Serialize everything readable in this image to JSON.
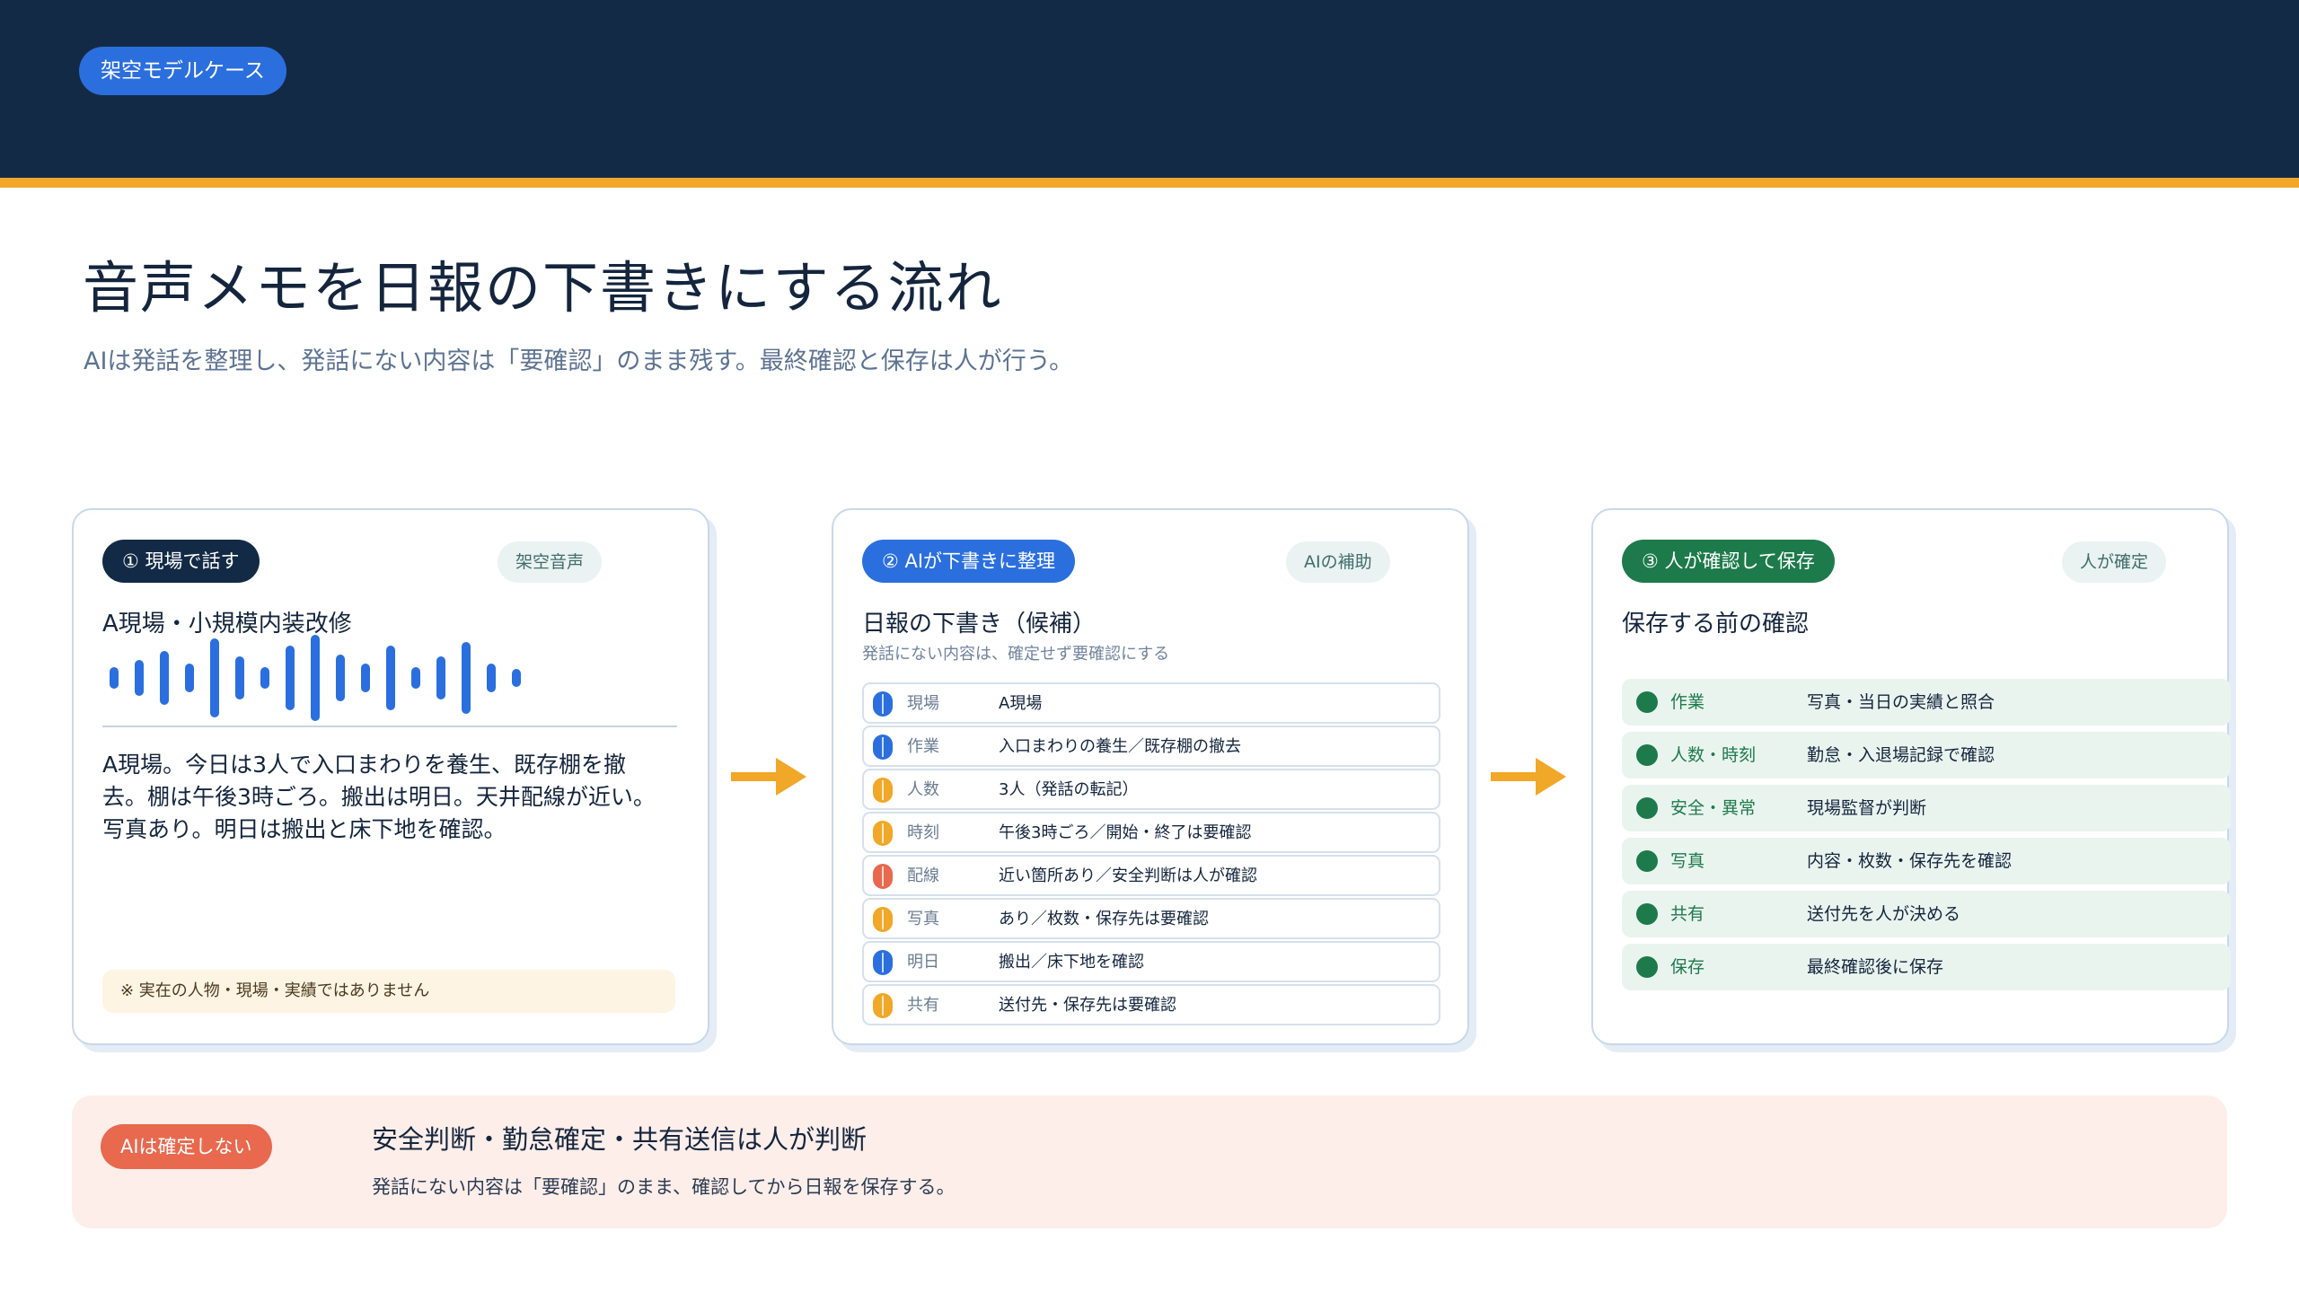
{
  "header": {
    "case_label": "架空モデルケース"
  },
  "title": "音声メモを日報の下書きにする流れ",
  "subtitle": "AIは発話を整理し、発話にない内容は「要確認」のまま残す。最終確認と保存は人が行う。",
  "colors": {
    "navy": "#132a46",
    "accent_yellow": "#f1a727",
    "blue": "#2b6fde",
    "orange": "#f1a727",
    "red": "#e8694e",
    "green": "#1d7a4b"
  },
  "step1": {
    "pill": "① 現場で話す",
    "tag": "架空音声",
    "heading": "A現場・小規模内装改修",
    "transcript": "A現場。今日は3人で入口まわりを養生、既存棚を撤去。棚は午後3時ごろ。搬出は明日。天井配線が近い。写真あり。明日は搬出と床下地を確認。",
    "disclaimer": "※ 実在の人物・現場・実績ではありません"
  },
  "step2": {
    "pill": "② AIが下書きに整理",
    "tag": "AIの補助",
    "heading": "日報の下書き（候補）",
    "note": "発話にない内容は、確定せず要確認にする",
    "rows": [
      {
        "key": "現場",
        "value": "A現場",
        "status": "blue"
      },
      {
        "key": "作業",
        "value": "入口まわりの養生／既存棚の撤去",
        "status": "blue"
      },
      {
        "key": "人数",
        "value": "3人（発話の転記）",
        "status": "orange"
      },
      {
        "key": "時刻",
        "value": "午後3時ごろ／開始・終了は要確認",
        "status": "orange"
      },
      {
        "key": "配線",
        "value": "近い箇所あり／安全判断は人が確認",
        "status": "red"
      },
      {
        "key": "写真",
        "value": "あり／枚数・保存先は要確認",
        "status": "orange"
      },
      {
        "key": "明日",
        "value": "搬出／床下地を確認",
        "status": "blue"
      },
      {
        "key": "共有",
        "value": "送付先・保存先は要確認",
        "status": "orange"
      }
    ]
  },
  "step3": {
    "pill": "③ 人が確認して保存",
    "tag": "人が確定",
    "heading": "保存する前の確認",
    "rows": [
      {
        "key": "作業",
        "value": "写真・当日の実績と照合"
      },
      {
        "key": "人数・時刻",
        "value": "勤怠・入退場記録で確認"
      },
      {
        "key": "安全・異常",
        "value": "現場監督が判断"
      },
      {
        "key": "写真",
        "value": "内容・枚数・保存先を確認"
      },
      {
        "key": "共有",
        "value": "送付先を人が決める"
      },
      {
        "key": "保存",
        "value": "最終確認後に保存"
      }
    ]
  },
  "footer": {
    "pill": "AIは確定しない",
    "title": "安全判断・勤怠確定・共有送信は人が判断",
    "sub": "発話にない内容は「要確認」のまま、確認してから日報を保存する。"
  }
}
